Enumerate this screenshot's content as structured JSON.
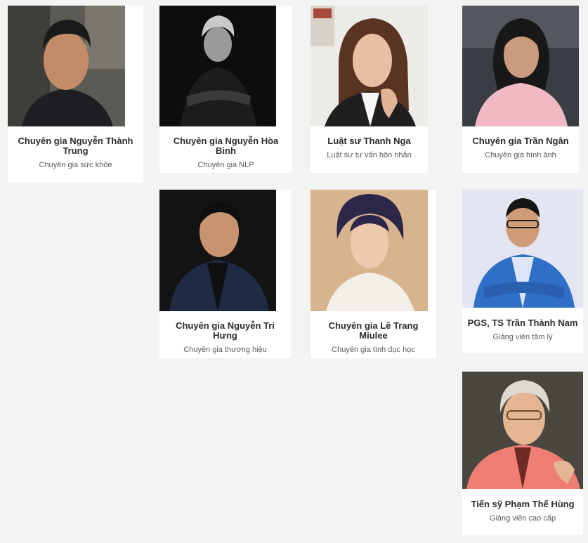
{
  "experts": [
    {
      "name": "Chuyên gia Nguyễn Thành Trung",
      "role": "Chuyên gia sức khỏe",
      "photo": "portrait-man-casual"
    },
    {
      "name": "Chuyên gia Nguyễn Hòa Bình",
      "role": "Chuyên gia NLP",
      "photo": "portrait-bw-arms-crossed"
    },
    {
      "name": "Luật sư Thanh Nga",
      "role": "Luật sư tư vấn hôn nhân",
      "photo": "portrait-woman-office"
    },
    {
      "name": "Chuyên gia Trần Ngân",
      "role": "Chuyên gia hình ảnh",
      "photo": "portrait-woman-pink"
    },
    {
      "name": "Chuyên gia Nguyễn Tri Hưng",
      "role": "Chuyên gia thương hiệu",
      "photo": "portrait-man-suit-dark"
    },
    {
      "name": "Chuyên gia Lê Trang Miulee",
      "role": "Chuyên gia tình dục học",
      "photo": "portrait-woman-white-dress"
    },
    {
      "name": "PGS, TS Trần Thành Nam",
      "role": "Giảng viên tâm lý",
      "photo": "portrait-man-blue-blazer"
    },
    {
      "name": "Tiến sỹ Phạm Thế Hùng",
      "role": "Giảng viên cao cấp",
      "photo": "portrait-man-glasses-pink-shirt"
    }
  ],
  "colors": {
    "page_bg": "#f3f3f3",
    "card_bg": "#ffffff",
    "name_text": "#2b2b2b",
    "role_text": "#5a5a5a"
  }
}
